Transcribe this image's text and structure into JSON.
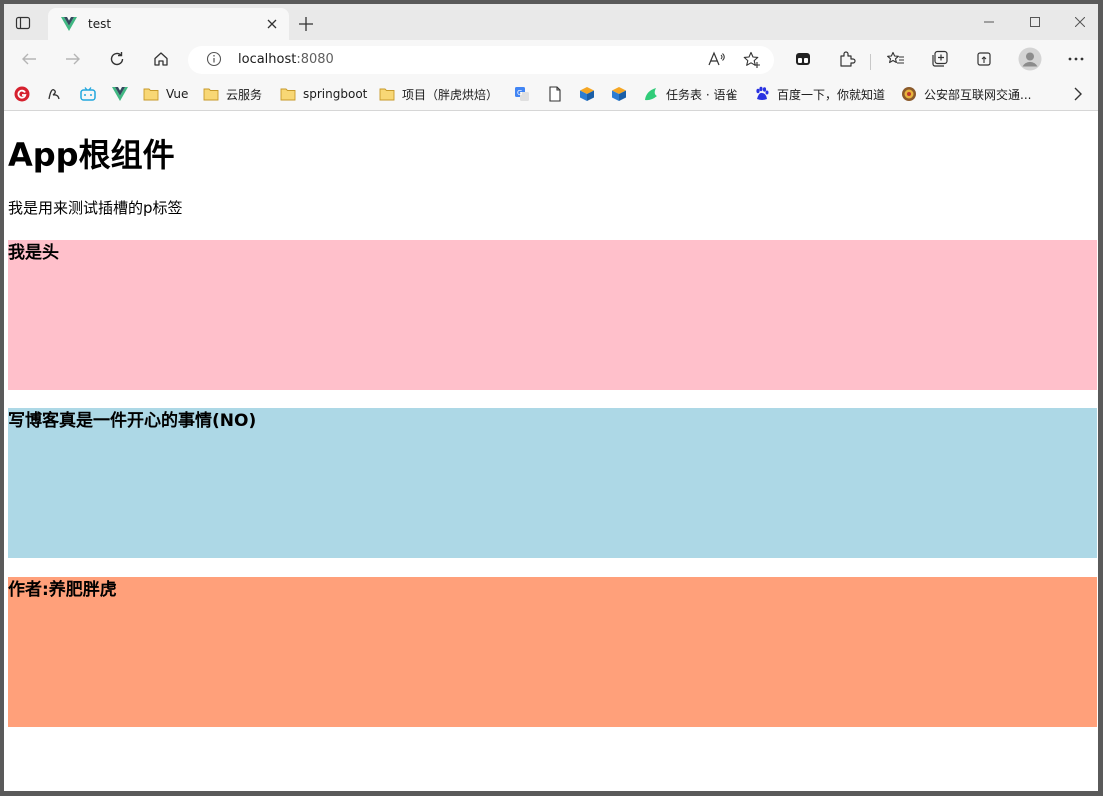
{
  "browser": {
    "tab_title": "test",
    "address": {
      "host": "localhost",
      "port": ":8080"
    },
    "bookmarks": [
      {
        "label": "",
        "icon": "g-icon"
      },
      {
        "label": "",
        "icon": "script-icon"
      },
      {
        "label": "",
        "icon": "bilibili-icon"
      },
      {
        "label": "",
        "icon": "vue-logo-icon"
      },
      {
        "label": "Vue",
        "icon": "folder-icon"
      },
      {
        "label": "云服务",
        "icon": "folder-icon"
      },
      {
        "label": "springboot",
        "icon": "folder-icon"
      },
      {
        "label": "项目（胖虎烘焙）",
        "icon": "folder-icon"
      },
      {
        "label": "",
        "icon": "translate-icon"
      },
      {
        "label": "",
        "icon": "page-icon"
      },
      {
        "label": "",
        "icon": "box-icon"
      },
      {
        "label": "",
        "icon": "box-icon"
      },
      {
        "label": "任务表 · 语雀",
        "icon": "yuque-icon"
      },
      {
        "label": "百度一下，你就知道",
        "icon": "baidu-icon"
      },
      {
        "label": "公安部互联网交通...",
        "icon": "police-icon"
      }
    ],
    "colors": {
      "tabstrip": "#e9e9e9",
      "toolbar": "#f7f7f7",
      "vue_green": "#41b883",
      "vue_dark": "#34495e"
    }
  },
  "page": {
    "title": "App根组件",
    "slot_text": "我是用来测试插槽的p标签",
    "header_text": "我是头",
    "main_text": "写博客真是一件开心的事情(NO)",
    "footer_text": "作者:养肥胖虎",
    "colors": {
      "header_bg": "#ffc0cb",
      "main_bg": "#add8e6",
      "footer_bg": "#ffa07a"
    }
  }
}
